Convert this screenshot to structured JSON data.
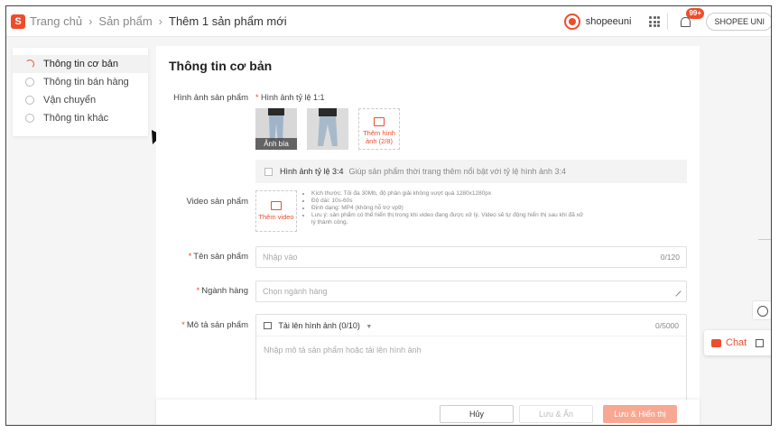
{
  "header": {
    "logo_letter": "S",
    "breadcrumb": [
      "Trang chủ",
      "Sản phẩm",
      "Thêm 1 sản phẩm mới"
    ],
    "shop_name": "shopeeuni",
    "notification_count": "99+",
    "uni_button": "SHOPEE UNI"
  },
  "sidebar": {
    "items": [
      {
        "label": "Thông tin cơ bản",
        "active": true
      },
      {
        "label": "Thông tin bán hàng",
        "active": false
      },
      {
        "label": "Vận chuyển",
        "active": false
      },
      {
        "label": "Thông tin khác",
        "active": false
      }
    ]
  },
  "main": {
    "title": "Thông tin cơ bản",
    "images": {
      "label": "Hình ảnh sản phẩm",
      "ratio_label": "Hình ảnh tỷ lệ 1:1",
      "cover_tag": "Ảnh bìa",
      "add_label": "Thêm hình ảnh (2/8)"
    },
    "ratio34": {
      "label": "Hình ảnh tỷ lệ 3:4",
      "hint": "Giúp sản phẩm thời trang thêm nổi bật với tỷ lệ hình ảnh 3:4"
    },
    "video": {
      "label": "Video sản phẩm",
      "add_label": "Thêm video",
      "notes": [
        "Kích thước: Tối đa 30Mb, độ phân giải không vượt quá 1280x1280px",
        "Độ dài: 10s-60s",
        "Định dạng: MP4 (không hỗ trợ vp9)",
        "Lưu ý: sản phẩm có thể hiển thị trong khi video đang được xử lý. Video sẽ tự động hiển thị sau khi đã xử lý thành công."
      ]
    },
    "name": {
      "label": "Tên sản phẩm",
      "placeholder": "Nhập vào",
      "count": "0/120"
    },
    "category": {
      "label": "Ngành hàng",
      "placeholder": "Chọn ngành hàng"
    },
    "description": {
      "label": "Mô tả sản phẩm",
      "upload_label": "Tải lên hình ảnh (0/10)",
      "count": "0/5000",
      "placeholder": "Nhập mô tả sản phẩm hoặc tải lên hình ảnh"
    }
  },
  "footer": {
    "cancel": "Hủy",
    "save_hide": "Lưu & Ẩn",
    "save_show": "Lưu & Hiển thị"
  },
  "chat": {
    "label": "Chat"
  },
  "colors": {
    "accent": "#ee4d2d",
    "publish_disabled": "#f8a892"
  },
  "icons": [
    "shopee-logo-icon",
    "shop-avatar-icon",
    "apps-grid-icon",
    "bell-icon",
    "image-add-icon",
    "video-add-icon",
    "pencil-icon",
    "picture-icon",
    "help-icon",
    "chat-icon",
    "expand-icon",
    "cursor-icon"
  ]
}
